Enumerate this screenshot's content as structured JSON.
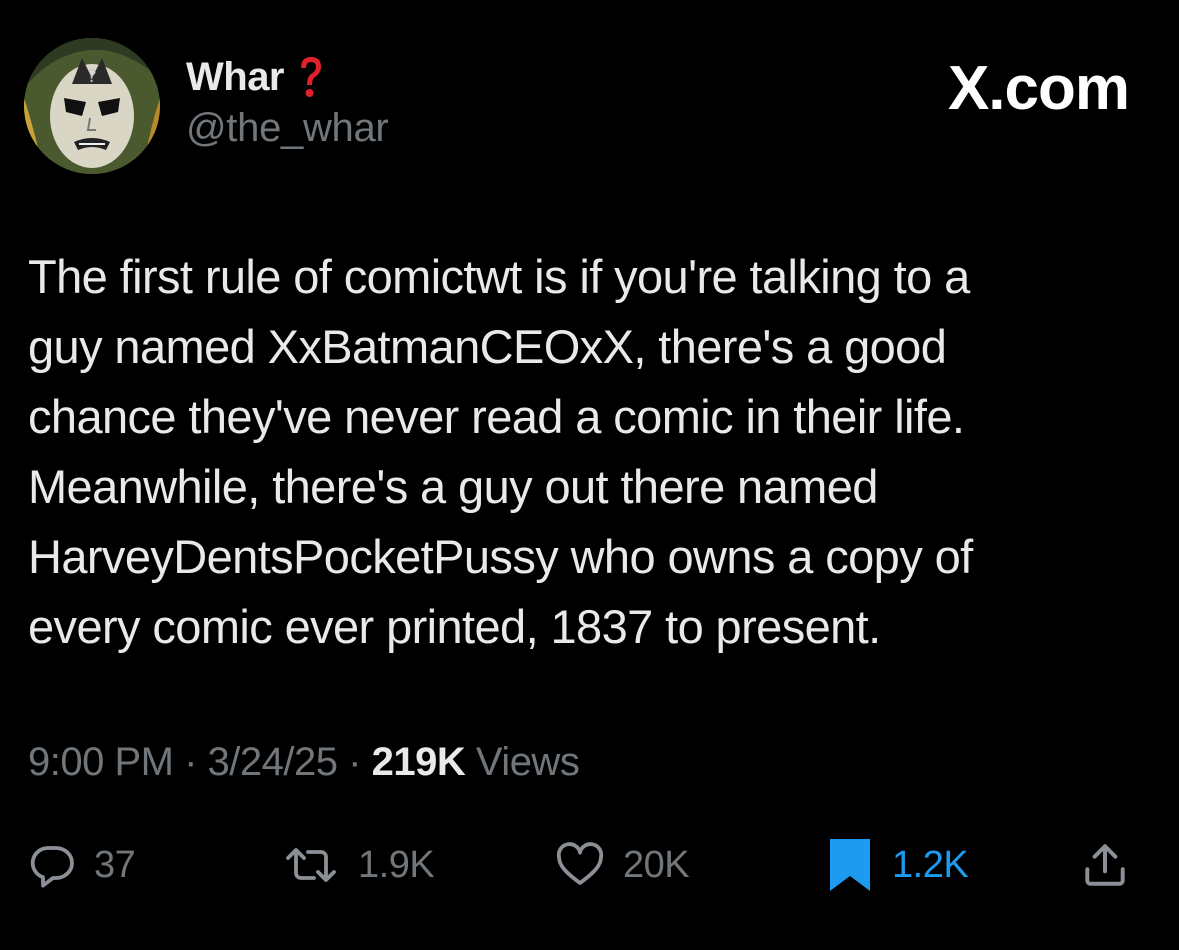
{
  "author": {
    "display_name": "Whar",
    "name_emoji": "red-question-mark-icon",
    "handle": "@the_whar",
    "avatar": "comic-character-face-paint-avatar"
  },
  "brand": {
    "text": "X.com"
  },
  "tweet": {
    "lines": [
      "The first rule of comictwt is if you're talking to a",
      "guy named XxBatmanCEOxX, there's a good",
      "chance they've never read a comic in their life.",
      "Meanwhile, there's a guy out there named",
      "HarveyDentsPocketPussy who owns a copy of",
      "every comic ever printed, 1837 to present."
    ]
  },
  "meta": {
    "time": "9:00 PM",
    "separator": "·",
    "date": "3/24/25",
    "views_count": "219K",
    "views_label": "Views"
  },
  "actions": {
    "reply": {
      "icon": "reply-icon",
      "count": "37"
    },
    "retweet": {
      "icon": "retweet-icon",
      "count": "1.9K"
    },
    "like": {
      "icon": "heart-icon",
      "count": "20K"
    },
    "bookmark": {
      "icon": "bookmark-icon",
      "count": "1.2K",
      "active": true
    },
    "share": {
      "icon": "share-icon"
    }
  },
  "colors": {
    "background": "#000000",
    "text_primary": "#e7e9ea",
    "text_secondary": "#71767b",
    "accent_blue": "#1d9bf0",
    "emoji_red": "#e0202a"
  }
}
